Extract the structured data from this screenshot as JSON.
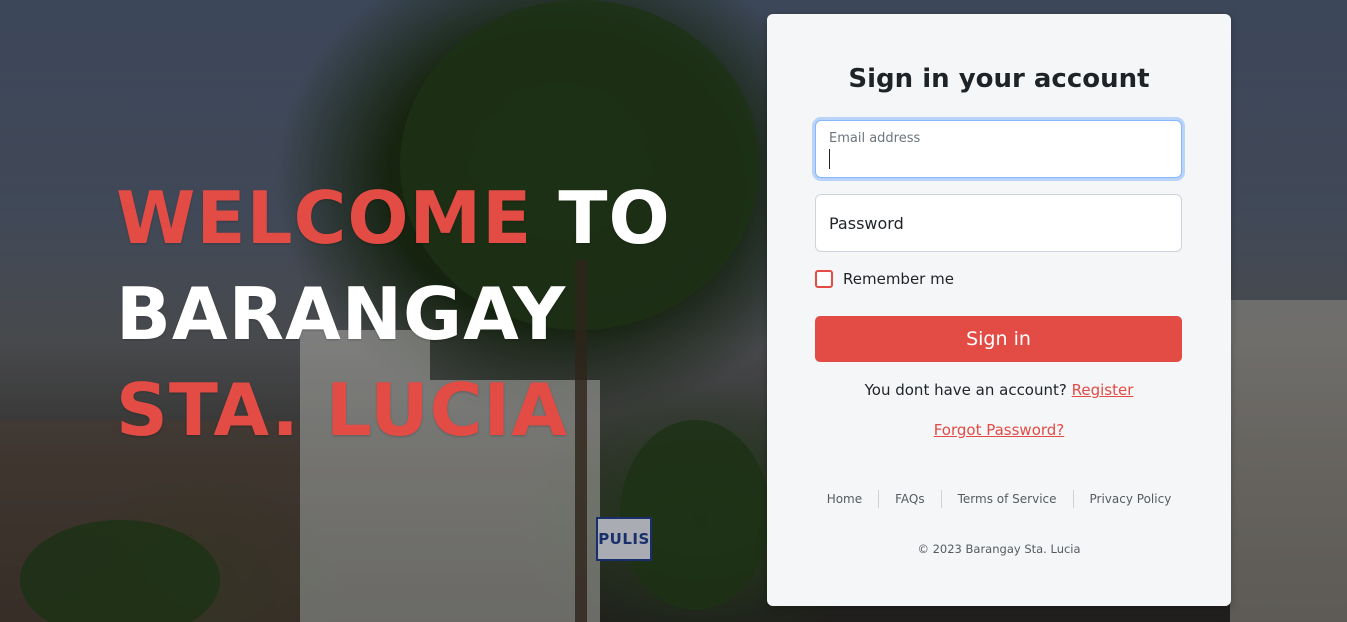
{
  "hero": {
    "welcome_word": "WELCOME",
    "to_word": " TO",
    "line2": "BARANGAY",
    "line3": "STA. LUCIA"
  },
  "background": {
    "sign_text": "PULIS"
  },
  "login": {
    "title": "Sign in your account",
    "email_label": "Email address",
    "password_label": "Password",
    "remember_label": "Remember me",
    "signin_label": "Sign in",
    "no_account_text": "You dont have an account? ",
    "register_link": "Register",
    "forgot_link": "Forgot Password?"
  },
  "footer": {
    "links": [
      "Home",
      "FAQs",
      "Terms of Service",
      "Privacy Policy"
    ],
    "copyright": "© 2023 Barangay Sta. Lucia"
  },
  "colors": {
    "accent": "#e34b45",
    "card_bg": "#f5f6f8",
    "focus_ring": "#86b7fe"
  }
}
